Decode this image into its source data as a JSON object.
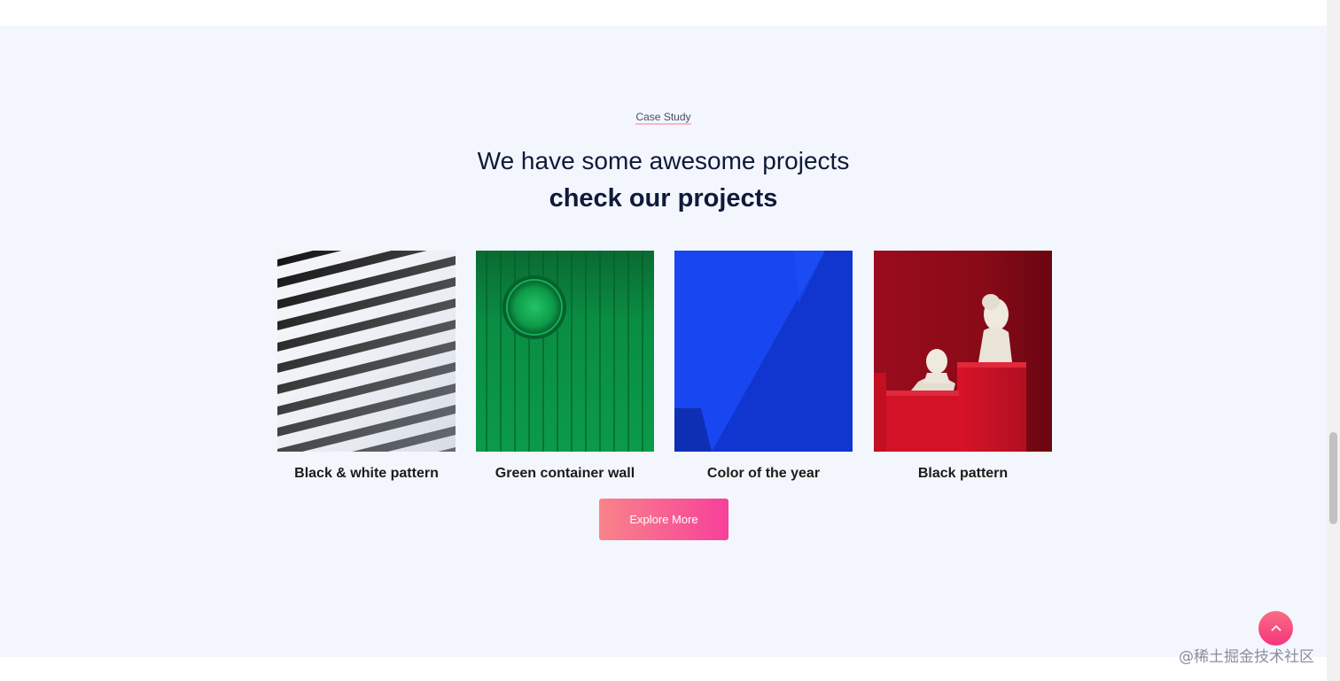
{
  "section": {
    "eyebrow": "Case Study",
    "title": "We have some awesome projects",
    "title_strong": "check our projects"
  },
  "projects": [
    {
      "caption": "Black & white pattern",
      "image": "black-white-stripes-image"
    },
    {
      "caption": "Green container wall",
      "image": "green-container-image"
    },
    {
      "caption": "Color of the year",
      "image": "blue-wall-image"
    },
    {
      "caption": "Black pattern",
      "image": "red-sculptures-image"
    }
  ],
  "cta": {
    "label": "Explore More"
  },
  "back_to_top": {
    "icon": "chevron-up-icon"
  },
  "watermark": "@稀土掘金技术社区",
  "colors": {
    "section_bg": "#f4f6fd",
    "heading": "#0e1a3a",
    "accent_start": "#f9848a",
    "accent_end": "#f7409a"
  }
}
